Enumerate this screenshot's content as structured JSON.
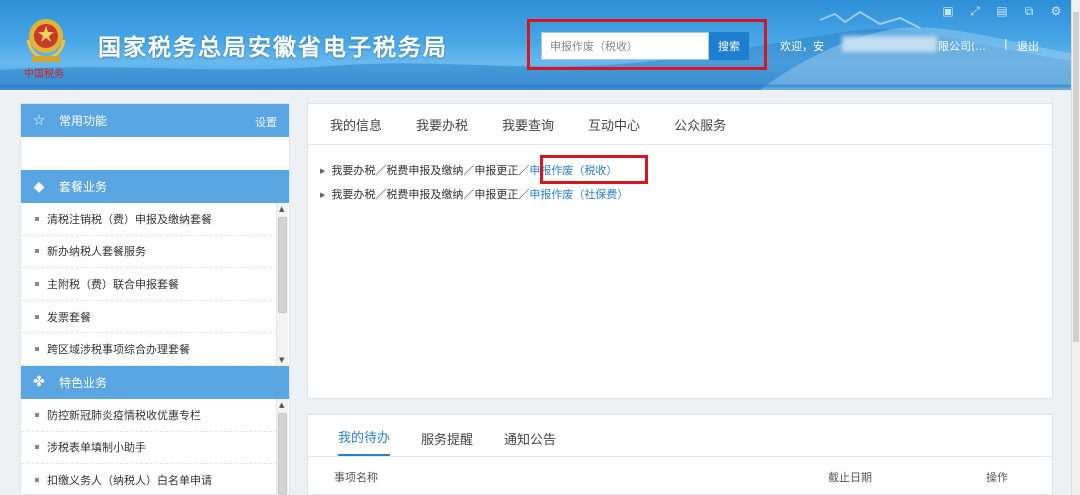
{
  "header": {
    "site_title": "国家税务总局安徽省电子税务局",
    "search_placeholder": "申报作废（税收）",
    "search_button": "搜索",
    "welcome": "欢迎，安",
    "company": "限公司(...",
    "separator": "|",
    "logout": "退出",
    "window_icons": [
      "fullscreen-icon",
      "expand-icon",
      "save-icon",
      "share-icon",
      "settings-icon"
    ]
  },
  "sidebar": {
    "common_title": "常用功能",
    "settings_label": "设置",
    "package_title": "套餐业务",
    "package_items": [
      "清税注销税（费）申报及缴纳套餐",
      "新办纳税人套餐服务",
      "主附税（费）联合申报套餐",
      "发票套餐",
      "跨区域涉税事项综合办理套餐"
    ],
    "special_title": "特色业务",
    "special_items": [
      "防控新冠肺炎疫情税收优惠专栏",
      "涉税表单填制小助手",
      "扣缴义务人（纳税人）白名单申请"
    ]
  },
  "main": {
    "tabs": [
      "我的信息",
      "我要办税",
      "我要查询",
      "互动中心",
      "公众服务"
    ],
    "results": [
      {
        "path": "我要办税／税费申报及缴纳／申报更正／",
        "link": "申报作废（税收）"
      },
      {
        "path": "我要办税／税费申报及缴纳／申报更正／",
        "link": "申报作废（社保费）"
      }
    ]
  },
  "todo": {
    "tabs": [
      "我的待办",
      "服务提醒",
      "通知公告"
    ],
    "active_tab": "我的待办",
    "columns": [
      "事项名称",
      "截止日期",
      "操作"
    ]
  },
  "colors": {
    "header_blue": "#3d97d8",
    "sidebar_head": "#5aa6e2",
    "link_blue": "#2a7fd0",
    "highlight_red": "#d9161d"
  }
}
